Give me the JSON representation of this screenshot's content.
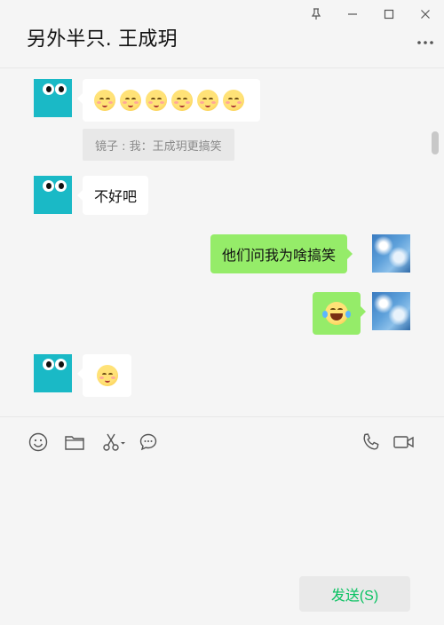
{
  "window": {
    "title": "另外半只. 王成玥",
    "controls": [
      "pin-icon",
      "minimize-icon",
      "maximize-icon",
      "close-icon"
    ],
    "more_icon": "more-dots-icon"
  },
  "messages": [
    {
      "side": "in",
      "type": "emoji",
      "emoji": "blush-smile",
      "count": 6
    },
    {
      "side": "quote",
      "text": "镜子 : 我：王成玥更搞笑"
    },
    {
      "side": "in",
      "type": "text",
      "text": "不好吧"
    },
    {
      "side": "out",
      "type": "text",
      "text": "他们问我为啥搞笑"
    },
    {
      "side": "out",
      "type": "emoji",
      "emoji": "tears-of-joy"
    },
    {
      "side": "in",
      "type": "emoji",
      "emoji": "blush-smile",
      "count": 1
    }
  ],
  "toolbar": {
    "left": [
      "emoji-icon",
      "folder-icon",
      "scissors-icon",
      "chat-bubble-icon"
    ],
    "right": [
      "phone-icon",
      "video-icon"
    ]
  },
  "composer": {
    "send_label": "发送(S)"
  },
  "colors": {
    "accent_green": "#07c160",
    "outgoing_bubble": "#95ec69",
    "incoming_bubble": "#ffffff",
    "background": "#f5f5f5",
    "bot_avatar": "#1ab9c6"
  }
}
